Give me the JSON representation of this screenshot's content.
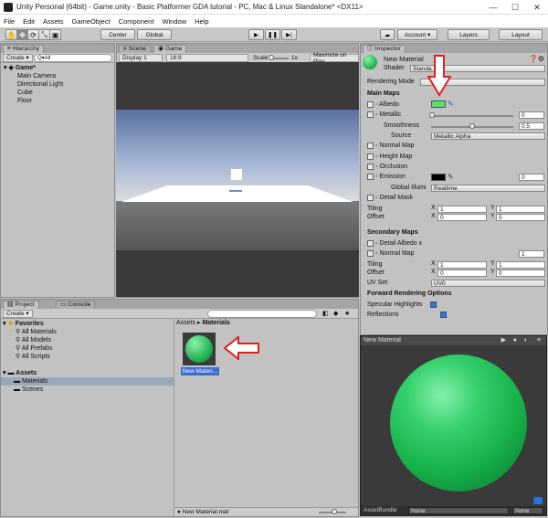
{
  "window": {
    "title": "Unity Personal (64bit) - Game.unity - Basic Platformer GDA tutorial - PC, Mac & Linux Standalone* <DX11>",
    "controls": [
      "—",
      "☐",
      "✕"
    ]
  },
  "menu": [
    "File",
    "Edit",
    "Assets",
    "GameObject",
    "Component",
    "Window",
    "Help"
  ],
  "toolbar": {
    "tools": [
      "✋",
      "✥",
      "⟳",
      "⤡",
      "▣"
    ],
    "pivot": "Center",
    "space": "Global",
    "play": "▶",
    "pause": "❚❚",
    "step": "▶|",
    "cloud": "☁",
    "account": "Account ▾",
    "layers": "Layers",
    "layout": "Layout"
  },
  "hierarchy": {
    "tab": "Hierarchy",
    "create": "Create ▾",
    "search_prefix": "Q▾All",
    "scene": "Game*",
    "items": [
      "Main Camera",
      "Directional Light",
      "Cube",
      "Floor"
    ]
  },
  "scene_tabs": {
    "scene": "Scene",
    "game": "Game",
    "display": "Display 1",
    "aspect": "16:9",
    "scale_label": "Scale",
    "scale_value": "1x",
    "maximize": "Maximize on Play"
  },
  "inspector": {
    "tab": "Inspector",
    "name": "New Material",
    "shader_label": "Shader",
    "shader_value": "Standa",
    "rendering_mode_label": "Rendering Mode",
    "main_maps": "Main Maps",
    "albedo": "Albedo",
    "albedo_color": "#55e06f",
    "metallic": "Metallic",
    "metallic_value": "0",
    "smoothness": "Smoothness",
    "smoothness_value": "0.5",
    "source": "Source",
    "source_value": "Metallic Alpha",
    "normal_map": "Normal Map",
    "height_map": "Height Map",
    "occlusion": "Occlusion",
    "emission": "Emission",
    "emission_value": "0",
    "global_illum": "Global Illumi",
    "global_illum_value": "Realtime",
    "detail_mask": "Detail Mask",
    "tiling": "Tiling",
    "offset": "Offset",
    "tiling_x": "1",
    "tiling_y": "1",
    "offset_x": "0",
    "offset_y": "0",
    "secondary_maps": "Secondary Maps",
    "detail_albedo": "Detail Albedo x",
    "sec_normal_map": "Normal Map",
    "sec_normal_value": "1",
    "sec_tiling_x": "1",
    "sec_tiling_y": "1",
    "sec_offset_x": "0",
    "sec_offset_y": "0",
    "uv_set": "UV Set",
    "uv_value": "UV0",
    "forward": "Forward Rendering Options",
    "specular": "Specular Highlights",
    "reflections": "Reflections"
  },
  "preview": {
    "title": "New Material",
    "assetbundle_label": "AssetBundle",
    "assetbundle_value": "None",
    "assetbundle_variant": "None"
  },
  "project": {
    "tab": "Project",
    "console_tab": "Console",
    "create": "Create ▾",
    "favorites": "Favorites",
    "favorites_items": [
      "All Materials",
      "All Models",
      "All Prefabs",
      "All Scripts"
    ],
    "assets": "Assets",
    "assets_items": [
      "Materials",
      "Scenes"
    ],
    "breadcrumb_root": "Assets",
    "breadcrumb_sep": "▸",
    "breadcrumb_current": "Materials",
    "asset_label": "New Materi...",
    "footer_file": "New Material.mat"
  }
}
